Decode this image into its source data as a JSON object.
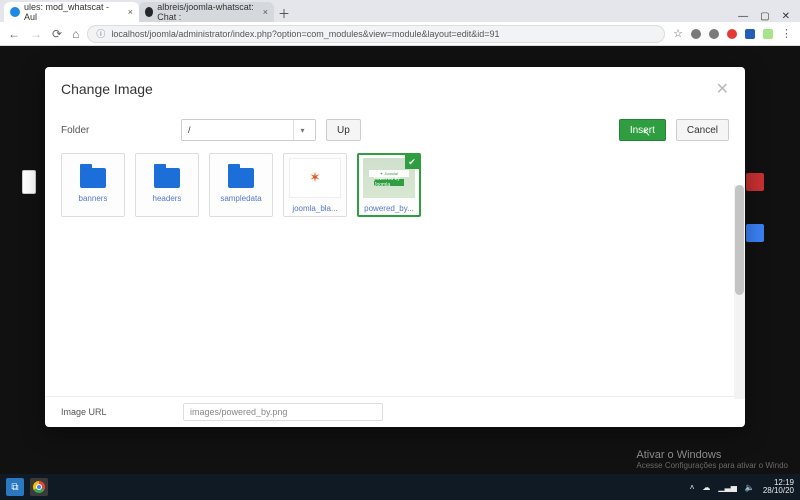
{
  "browser": {
    "tabs": [
      {
        "title": "ules: mod_whatscat - Aul",
        "favicon_color": "#1e88e5"
      },
      {
        "title": "albreis/joomla-whatscat: Chat :",
        "favicon_color": "#24292e"
      }
    ],
    "address": "localhost/joomla/administrator/index.php?option=com_modules&view=module&layout=edit&id=91",
    "window_controls": {
      "min": "—",
      "max": "▢",
      "close": "✕"
    },
    "tool_icons": {
      "star": "☆",
      "eye_color": "#7a7a7a",
      "shield_color": "#7a7a7a",
      "red_color": "#e53935",
      "blue_color": "#215db9",
      "ext_color": "#a7e489",
      "menu": "⋮"
    }
  },
  "modal": {
    "title": "Change Image",
    "close_glyph": "✕",
    "folder_label": "Folder",
    "folder_value": "/",
    "up_label": "Up",
    "insert_label": "Insert",
    "cancel_label": "Cancel",
    "url_label": "Image URL",
    "url_value": "images/powered_by.png",
    "items": [
      {
        "type": "folder",
        "label": "banners"
      },
      {
        "type": "folder",
        "label": "headers"
      },
      {
        "type": "folder",
        "label": "sampledata"
      },
      {
        "type": "image",
        "label": "joomla_bla..."
      },
      {
        "type": "image",
        "label": "powered_by...",
        "selected": true
      }
    ]
  },
  "watermark": {
    "line1": "Ativar o Windows",
    "line2": "Acesse Configurações para ativar o Windo"
  },
  "taskbar": {
    "tray": {
      "chevron": "˄",
      "cloud": "☁",
      "wifi": "▁▃▅",
      "sound": "🔈",
      "time": "12:19",
      "date": "28/10/20"
    }
  }
}
